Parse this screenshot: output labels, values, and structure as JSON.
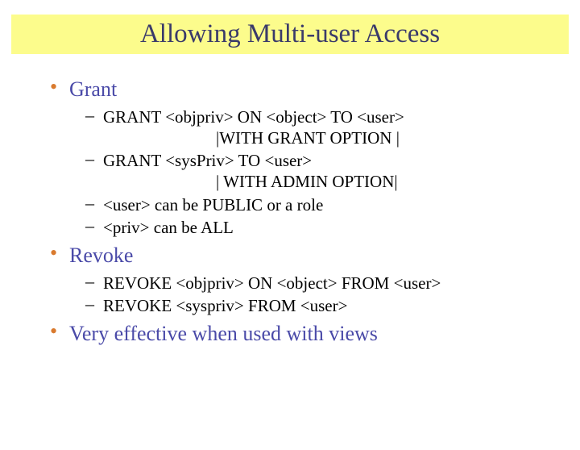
{
  "title": "Allowing Multi-user Access",
  "bullets": [
    {
      "label": "Grant",
      "sub": [
        {
          "text": "GRANT <objpriv> ON <object> TO <user>",
          "cont": "|WITH GRANT OPTION |"
        },
        {
          "text": "GRANT <sysPriv> TO <user>",
          "cont": "| WITH ADMIN OPTION|"
        },
        {
          "text": "<user> can be PUBLIC or a role"
        },
        {
          "text": "<priv> can be ALL"
        }
      ]
    },
    {
      "label": "Revoke",
      "sub": [
        {
          "text": "REVOKE <objpriv> ON <object> FROM <user>"
        },
        {
          "text": "REVOKE <syspriv> FROM <user>"
        }
      ]
    },
    {
      "label": "Very effective when used with views"
    }
  ]
}
